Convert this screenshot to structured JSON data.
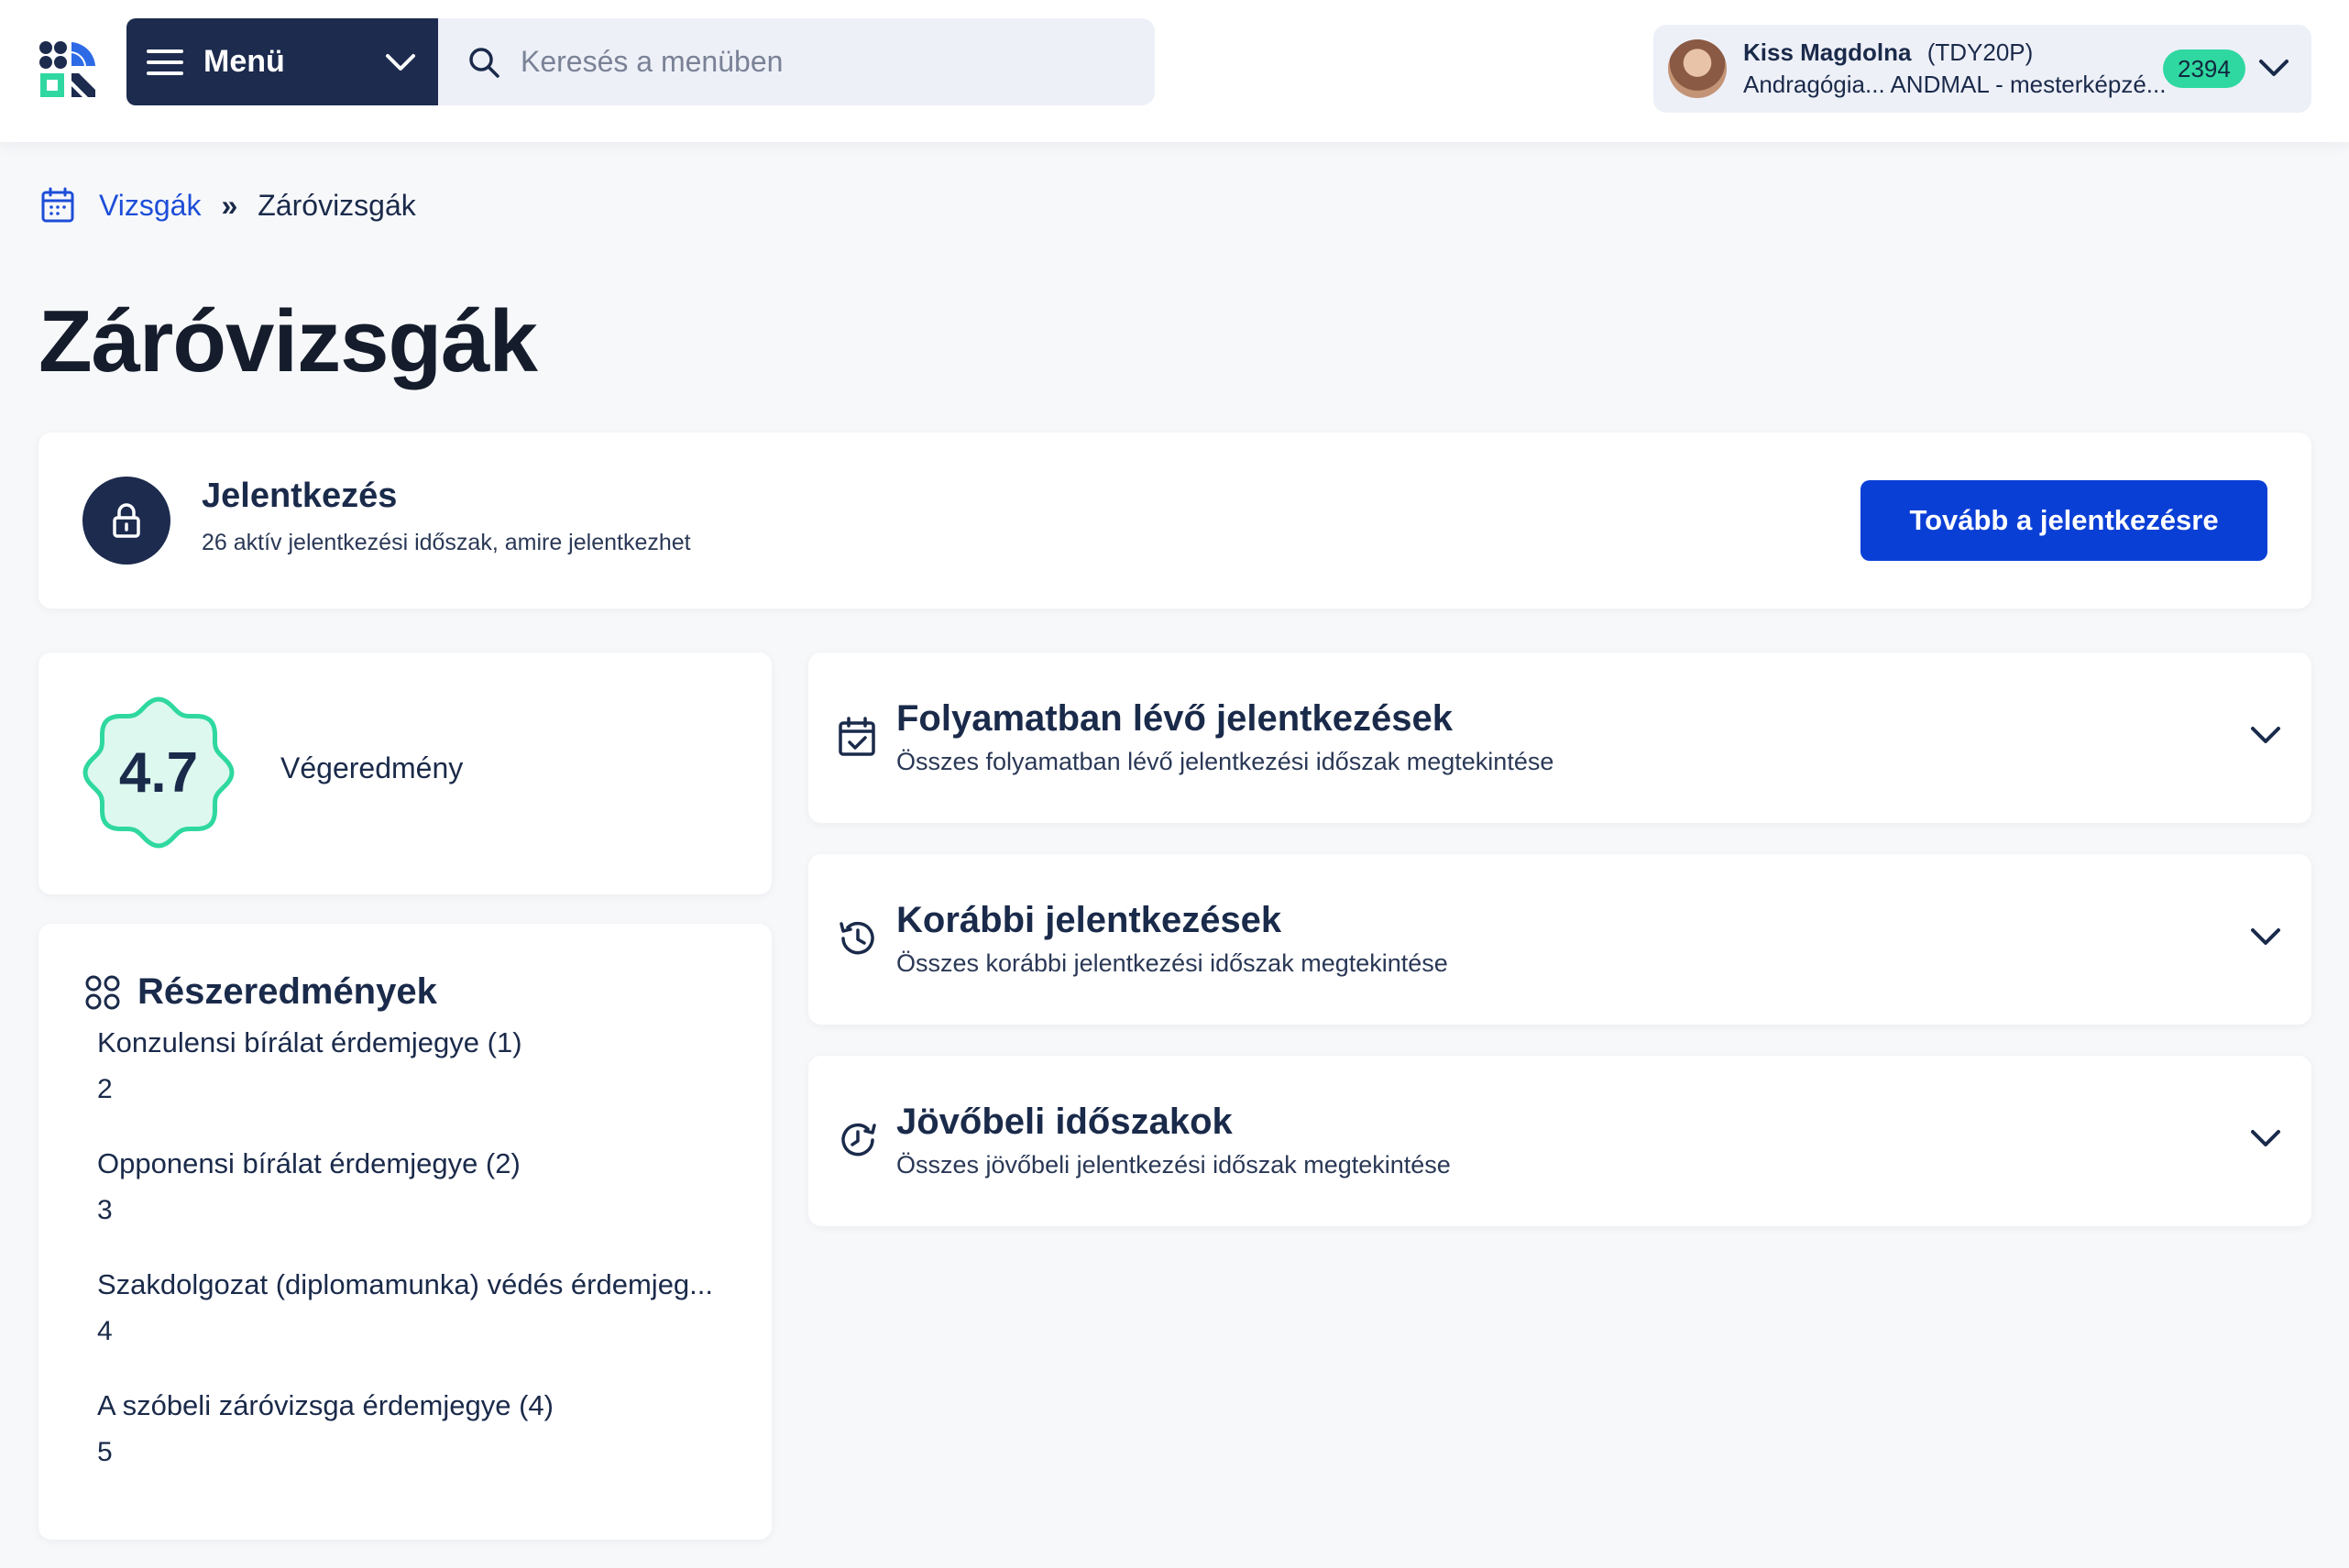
{
  "header": {
    "menu_label": "Menü",
    "search_placeholder": "Keresés a menüben",
    "user": {
      "name": "Kiss Magdolna",
      "code": "(TDY20P)",
      "program": "Andragógia... ANDMAL - mesterképzé...",
      "badge": "2394"
    }
  },
  "breadcrumb": {
    "parent": "Vizsgák",
    "separator": "»",
    "current": "Záróvizsgák"
  },
  "page_title": "Záróvizsgák",
  "registration": {
    "title": "Jelentkezés",
    "subtitle": "26 aktív jelentkezési időszak, amire jelentkezhet",
    "button": "Tovább a jelentkezésre"
  },
  "final_result": {
    "grade": "4.7",
    "label": "Végeredmény"
  },
  "partial_results": {
    "title": "Részeredmények",
    "items": [
      {
        "name": "Konzulensi bírálat érdemjegye (1)",
        "value": "2"
      },
      {
        "name": "Opponensi bírálat érdemjegye (2)",
        "value": "3"
      },
      {
        "name": "Szakdolgozat (diplomamunka) védés érdemjeg...",
        "value": "4"
      },
      {
        "name": "A szóbeli záróvizsga érdemjegye (4)",
        "value": "5"
      }
    ]
  },
  "accordions": [
    {
      "title": "Folyamatban lévő jelentkezések",
      "subtitle": "Összes folyamatban lévő jelentkezési időszak megtekintése",
      "icon": "calendar-check-icon"
    },
    {
      "title": "Korábbi jelentkezések",
      "subtitle": "Összes korábbi jelentkezési időszak megtekintése",
      "icon": "history-icon"
    },
    {
      "title": "Jövőbeli időszakok",
      "subtitle": "Összes jövőbeli jelentkezési időszak megtekintése",
      "icon": "future-clock-icon"
    }
  ],
  "colors": {
    "navy": "#1c2b4e",
    "primary_blue": "#0a3fd6",
    "link_blue": "#1d4ed8",
    "accent_green": "#2fd8a0",
    "grade_fill": "#ddf8ef",
    "grade_stroke": "#2fd8a0"
  }
}
